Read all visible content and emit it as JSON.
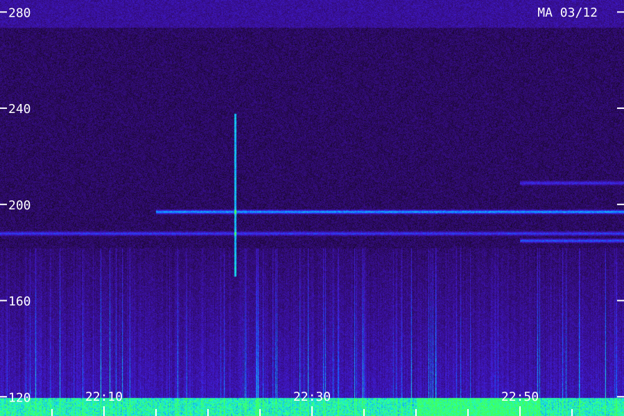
{
  "chart_data": {
    "type": "heatmap",
    "title": "MA 03/12",
    "y_ticks": [
      120,
      160,
      200,
      240,
      280
    ],
    "ylim": [
      112,
      285
    ],
    "x_labels": [
      "22:10",
      "22:30",
      "22:50"
    ],
    "xlim_minutes": [
      0,
      60
    ],
    "x_label_minutes": [
      10,
      30,
      50
    ],
    "x_minor_tick_step_minutes": 5,
    "colormap": [
      "#000000",
      "#2a0a55",
      "#3a10a0",
      "#4020e0",
      "#1060ff",
      "#10c0ff",
      "#20ffc0",
      "#40ff60"
    ],
    "features": {
      "noise_band_low": 118,
      "horizontal_lines": [
        {
          "freq": 197,
          "start_minute": 15,
          "intensity": 0.55
        },
        {
          "freq": 188,
          "start_minute": 0,
          "intensity": 0.35
        },
        {
          "freq": 185,
          "start_minute": 50,
          "intensity": 0.4
        },
        {
          "freq": 209,
          "start_minute": 50,
          "intensity": 0.3
        }
      ],
      "bright_vertical_streak": {
        "minute": 22.6,
        "freq_low": 170,
        "freq_high": 238
      }
    }
  }
}
